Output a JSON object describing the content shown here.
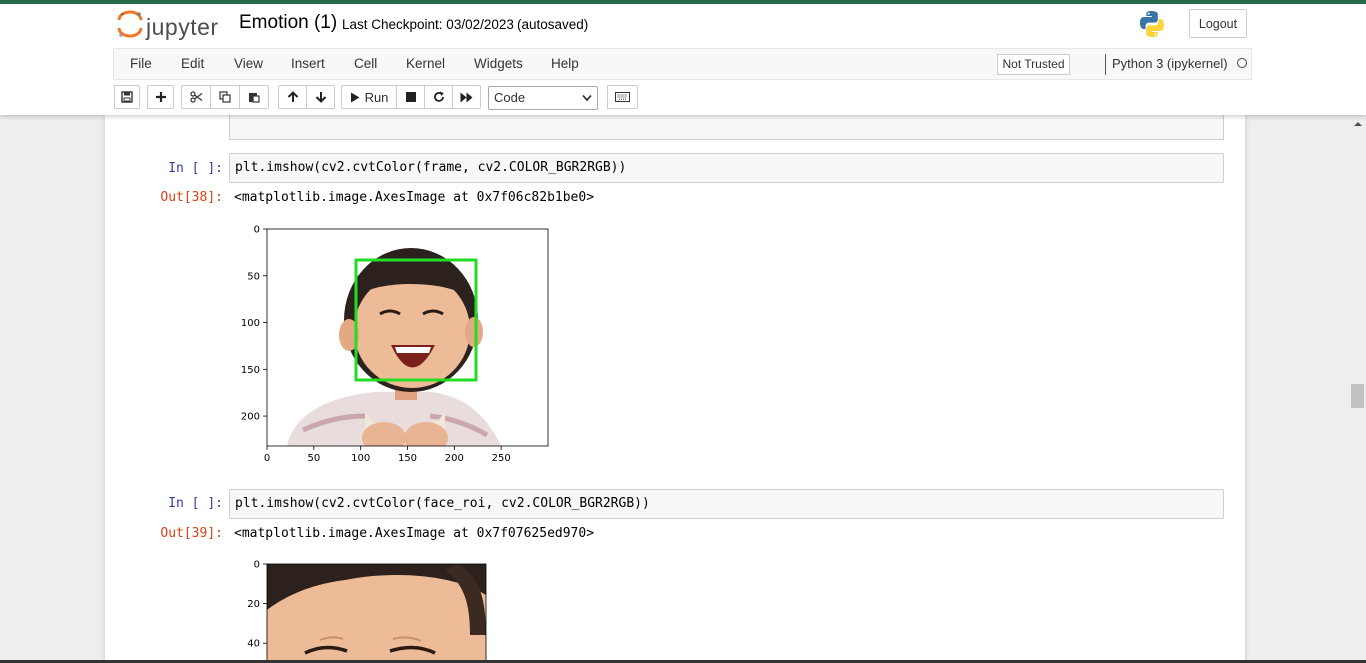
{
  "header": {
    "logo_text": "jupyter",
    "notebook_title": "Emotion (1)",
    "checkpoint": "Last Checkpoint: 03/02/2023",
    "autosave_status": "(autosaved)",
    "logout_label": "Logout",
    "accent_color": "#256b4e"
  },
  "menubar": {
    "items": [
      "File",
      "Edit",
      "View",
      "Insert",
      "Cell",
      "Kernel",
      "Widgets",
      "Help"
    ],
    "trust_status": "Not Trusted",
    "kernel_name": "Python 3 (ipykernel)"
  },
  "toolbar": {
    "run_label": "Run",
    "cell_type": "Code",
    "icons": [
      "save-icon",
      "plus-icon",
      "cut-icon",
      "copy-icon",
      "paste-icon",
      "arrow-up-icon",
      "arrow-down-icon",
      "play-icon",
      "stop-icon",
      "restart-icon",
      "fast-forward-icon",
      "keyboard-icon"
    ]
  },
  "cells": [
    {
      "in_prompt": "In [ ]:",
      "code": "plt.imshow(cv2.cvtColor(frame, cv2.COLOR_BGR2RGB))",
      "out_prompt": "Out[38]:",
      "output": "<matplotlib.image.AxesImage at 0x7f06c82b1be0>",
      "plot": {
        "x_ticks": [
          "0",
          "50",
          "100",
          "150",
          "200",
          "250"
        ],
        "y_ticks": [
          "0",
          "50",
          "100",
          "150",
          "200"
        ],
        "box_color": "#22dd22"
      }
    },
    {
      "in_prompt": "In [ ]:",
      "code": "plt.imshow(cv2.cvtColor(face_roi, cv2.COLOR_BGR2RGB))",
      "out_prompt": "Out[39]:",
      "output": "<matplotlib.image.AxesImage at 0x7f07625ed970>",
      "plot": {
        "y_ticks": [
          "0",
          "20",
          "40"
        ]
      }
    }
  ]
}
